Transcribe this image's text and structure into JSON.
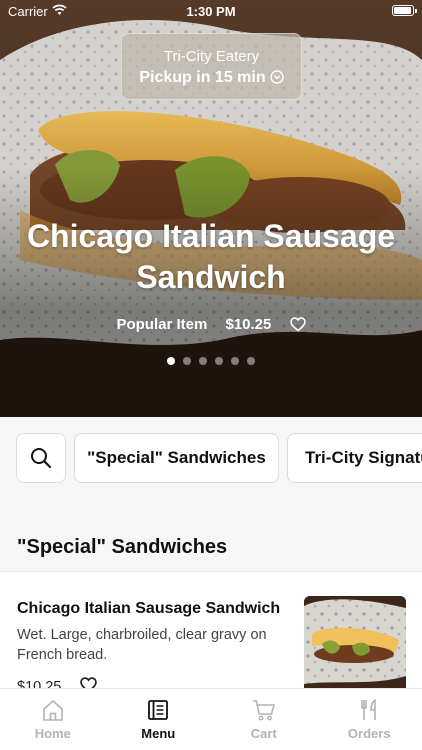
{
  "status_bar": {
    "carrier": "Carrier",
    "time": "1:30 PM"
  },
  "pickup": {
    "store": "Tri-City Eatery",
    "eta": "Pickup in 15 min"
  },
  "hero": {
    "title": "Chicago Italian Sausage Sandwich",
    "badge": "Popular Item",
    "price": "$10.25",
    "slide_count": 6,
    "active_slide": 1
  },
  "categories": {
    "items": [
      "\"Special\" Sandwiches",
      "Tri-City Signature"
    ]
  },
  "section": {
    "title": "\"Special\" Sandwiches",
    "items": [
      {
        "name": "Chicago Italian Sausage Sandwich",
        "description": "Wet. Large, charbroiled, clear gravy on French bread.",
        "price": "$10.25"
      }
    ]
  },
  "tabs": [
    {
      "label": "Home",
      "icon": "home-icon",
      "active": false
    },
    {
      "label": "Menu",
      "icon": "menu-icon",
      "active": true
    },
    {
      "label": "Cart",
      "icon": "cart-icon",
      "active": false
    },
    {
      "label": "Orders",
      "icon": "utensils-icon",
      "active": false
    }
  ],
  "colors": {
    "active_tab": "#111111",
    "inactive_tab": "#b3b3b3",
    "background": "#f6f6f6"
  }
}
